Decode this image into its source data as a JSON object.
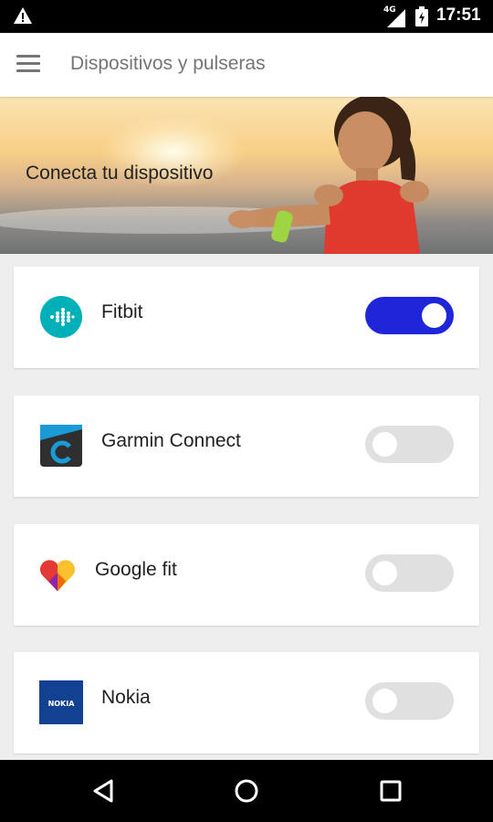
{
  "status_bar": {
    "time": "17:51",
    "network": "4G",
    "icons": [
      "warning-icon",
      "signal-icon",
      "battery-icon"
    ]
  },
  "app_bar": {
    "title": "Dispositivos y pulseras",
    "menu_icon": "hamburger-menu-icon"
  },
  "hero": {
    "text": "Conecta tu dispositivo"
  },
  "devices": [
    {
      "name": "Fitbit",
      "enabled": true,
      "icon": "fitbit-logo"
    },
    {
      "name": "Garmin Connect",
      "enabled": false,
      "icon": "garmin-connect-logo"
    },
    {
      "name": "Google fit",
      "enabled": false,
      "icon": "google-fit-logo"
    },
    {
      "name": "Nokia",
      "enabled": false,
      "icon": "nokia-logo",
      "logo_text": "NOKIA"
    }
  ],
  "nav_bar": {
    "icons": [
      "back-icon",
      "home-icon",
      "recents-icon"
    ]
  },
  "colors": {
    "toggle_on": "#1f25d9",
    "toggle_off": "#e0e0e0",
    "fitbit": "#00b0b9",
    "nokia": "#124191"
  }
}
